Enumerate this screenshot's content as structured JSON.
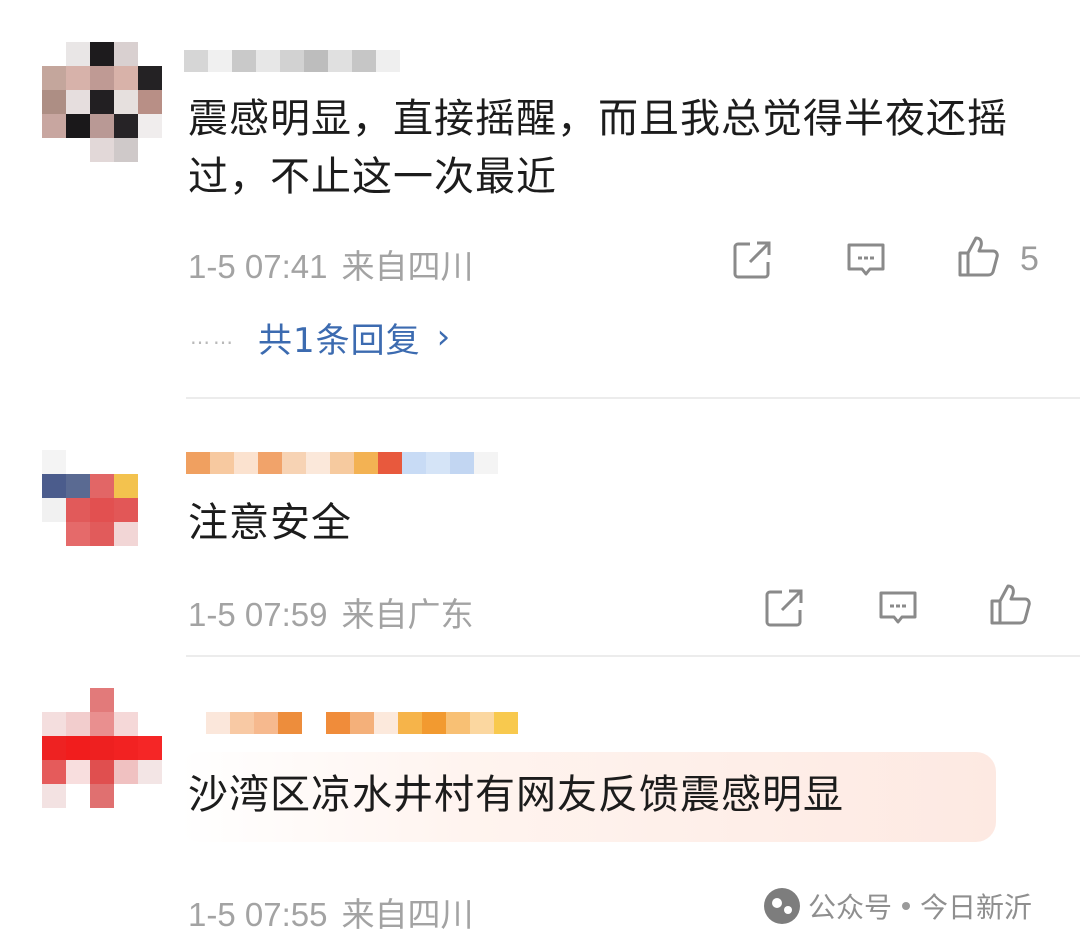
{
  "comments": [
    {
      "text": "震感明显，直接摇醒，而且我总觉得半夜还摇过，不止这一次最近",
      "time": "1-5 07:41",
      "location": "来自四川",
      "like_count": "5",
      "replies": {
        "dots": "……",
        "label": "共1条回复",
        "chevron": "›"
      }
    },
    {
      "text": "注意安全",
      "time": "1-5 07:59",
      "location": "来自广东"
    },
    {
      "text": "沙湾区凉水井村有网友反馈震感明显",
      "time": "1-5 07:55",
      "location": "来自四川"
    }
  ],
  "icons": {
    "share": "share-icon",
    "reply": "comment-icon",
    "like": "thumbs-up-icon"
  },
  "colors": {
    "link": "#3c6bb0",
    "meta": "#a3a3a3",
    "icon": "#8a8a8a"
  },
  "watermark": {
    "left": "公众号",
    "right": "今日新沂"
  }
}
